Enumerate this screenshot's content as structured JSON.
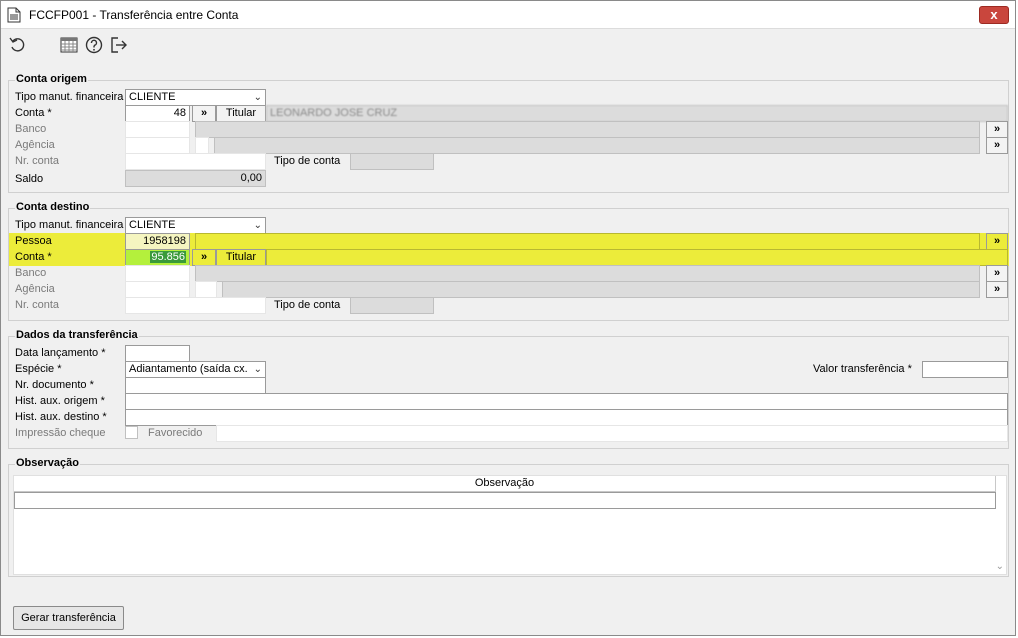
{
  "window": {
    "title": "FCCFP001 - Transferência entre Conta",
    "close_label": "x"
  },
  "toolbar": {
    "icons": [
      "undo-icon",
      "calendar-grid-icon",
      "help-icon",
      "exit-icon"
    ]
  },
  "origem": {
    "legend": "Conta origem",
    "tipo_label": "Tipo manut. financeira",
    "tipo_value": "CLIENTE",
    "conta_label": "Conta *",
    "conta_value": "48",
    "more_label": "»",
    "titular_label": "Titular",
    "titular_value": "LEONARDO JOSE CRUZ",
    "banco_label": "Banco",
    "agencia_label": "Agência",
    "nrconta_label": "Nr. conta",
    "tipoconta_label": "Tipo de conta",
    "saldo_label": "Saldo",
    "saldo_value": "0,00"
  },
  "destino": {
    "legend": "Conta destino",
    "tipo_label": "Tipo manut. financeira",
    "tipo_value": "CLIENTE",
    "pessoa_label": "Pessoa",
    "pessoa_value": "1958198",
    "conta_label": "Conta *",
    "conta_value": "95.856",
    "more_label": "»",
    "titular_label": "Titular",
    "banco_label": "Banco",
    "agencia_label": "Agência",
    "nrconta_label": "Nr. conta",
    "tipoconta_label": "Tipo de conta",
    "highlight_color": "#ecec3a"
  },
  "transferencia": {
    "legend": "Dados da transferência",
    "data_label": "Data lançamento *",
    "especie_label": "Espécie *",
    "especie_value": "Adiantamento (saída cx.",
    "nrdoc_label": "Nr. documento *",
    "hist_origem_label": "Hist. aux. origem *",
    "hist_destino_label": "Hist. aux. destino *",
    "impressao_label": "Impressão cheque",
    "favorecido_label": "Favorecido",
    "valor_label": "Valor transferência *"
  },
  "observacao": {
    "legend": "Observação",
    "column_header": "Observação"
  },
  "footer": {
    "gerar_label": "Gerar transferência"
  }
}
